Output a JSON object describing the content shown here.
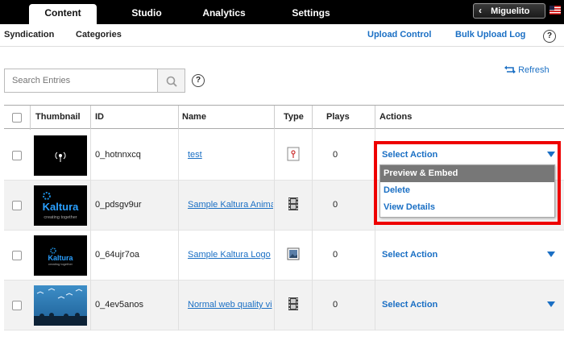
{
  "nav": {
    "tabs": [
      {
        "label": "Content",
        "active": true
      },
      {
        "label": "Studio",
        "active": false
      },
      {
        "label": "Analytics",
        "active": false
      },
      {
        "label": "Settings",
        "active": false
      }
    ],
    "user": "Miguelito"
  },
  "subnav": {
    "syndication": "Syndication",
    "categories": "Categories",
    "upload_control": "Upload Control",
    "bulk_upload_log": "Bulk Upload Log",
    "help": "?"
  },
  "search": {
    "placeholder": "Search Entries",
    "help": "?"
  },
  "refresh": "Refresh",
  "table": {
    "headers": {
      "thumbnail": "Thumbnail",
      "id": "ID",
      "name": "Name",
      "type": "Type",
      "plays": "Plays",
      "actions": "Actions"
    },
    "rows": [
      {
        "id": "0_hotnnxcq",
        "name": "test",
        "type": "audio-icon",
        "plays": "0",
        "action": "Select Action",
        "thumb": "podcast-icon"
      },
      {
        "id": "0_pdsgv9ur",
        "name": "Sample Kaltura Anima",
        "type": "video-icon",
        "plays": "0",
        "action": "",
        "thumb": "kaltura-logo"
      },
      {
        "id": "0_64ujr7oa",
        "name": "Sample Kaltura Logo",
        "type": "image-icon",
        "plays": "0",
        "action": "Select Action",
        "thumb": "kaltura-logo"
      },
      {
        "id": "0_4ev5anos",
        "name": "Normal web quality vi",
        "type": "video-icon",
        "plays": "0",
        "action": "Select Action",
        "thumb": "aquarium-image"
      }
    ]
  },
  "thumb_texts": {
    "kaltura": "Kaltura",
    "tagline": "creating together"
  },
  "dropdown": {
    "items": [
      {
        "label": "Preview & Embed",
        "selected": true
      },
      {
        "label": "Delete",
        "selected": false
      },
      {
        "label": "View Details",
        "selected": false
      }
    ]
  },
  "colors": {
    "link": "#1a6fc4",
    "highlight": "#ee0000",
    "selected_item": "#777777"
  }
}
